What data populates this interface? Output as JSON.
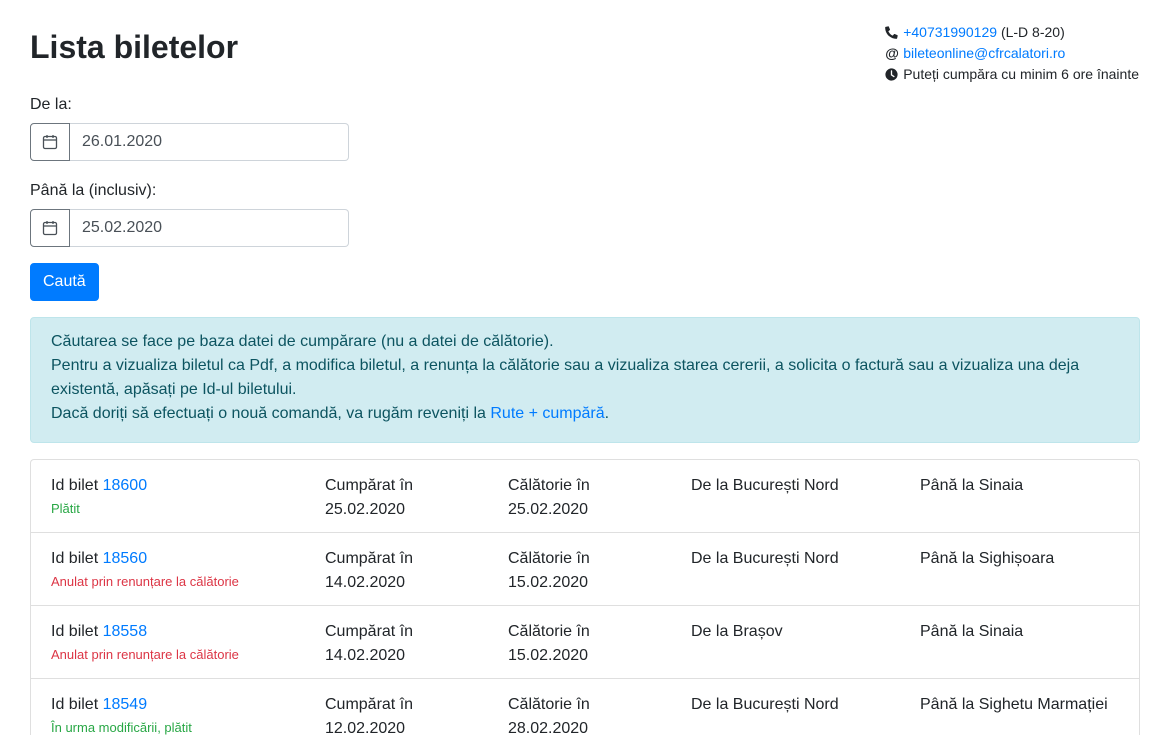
{
  "page": {
    "title": "Lista biletelor"
  },
  "contact": {
    "phone": "+40731990129",
    "phone_hours": "(L-D 8-20)",
    "email": "bileteonline@cfrcalatori.ro",
    "notice": "Puteți cumpăra cu minim 6 ore înainte",
    "icons": [
      "phone-icon",
      "at-icon",
      "clock-icon"
    ]
  },
  "filters": {
    "from_label": "De la:",
    "from_value": "26.01.2020",
    "to_label": "Până la (inclusiv):",
    "to_value": "25.02.2020",
    "search_label": "Caută"
  },
  "info": {
    "line1": "Căutarea se face pe baza datei de cumpărare (nu a datei de călătorie).",
    "line2": "Pentru a vizualiza biletul ca Pdf, a modifica biletul, a renunța la călătorie sau a vizualiza starea cererii, a solicita o factură sau a vizualiza una deja existentă, apăsați pe Id-ul biletului.",
    "line3_prefix": "Dacă doriți să efectuați o nouă comandă, va rugăm reveniți la ",
    "line3_link": "Rute + cumpără",
    "line3_suffix": "."
  },
  "tickets": [
    {
      "id_label": "Id bilet",
      "id": "18600",
      "status": "Plătit",
      "status_type": "ok",
      "bought_label": "Cumpărat în",
      "bought": "25.02.2020",
      "travel_label": "Călătorie în",
      "travel": "25.02.2020",
      "from": "De la București Nord",
      "to": "Până la Sinaia"
    },
    {
      "id_label": "Id bilet",
      "id": "18560",
      "status": "Anulat prin renunțare la călătorie",
      "status_type": "bad",
      "bought_label": "Cumpărat în",
      "bought": "14.02.2020",
      "travel_label": "Călătorie în",
      "travel": "15.02.2020",
      "from": "De la București Nord",
      "to": "Până la Sighișoara"
    },
    {
      "id_label": "Id bilet",
      "id": "18558",
      "status": "Anulat prin renunțare la călătorie",
      "status_type": "bad",
      "bought_label": "Cumpărat în",
      "bought": "14.02.2020",
      "travel_label": "Călătorie în",
      "travel": "15.02.2020",
      "from": "De la Brașov",
      "to": "Până la Sinaia"
    },
    {
      "id_label": "Id bilet",
      "id": "18549",
      "status": "În urma modificării, plătit",
      "status_type": "ok",
      "bought_label": "Cumpărat în",
      "bought": "12.02.2020",
      "travel_label": "Călătorie în",
      "travel": "28.02.2020",
      "from": "De la București Nord",
      "to": "Până la Sighetu Marmației"
    }
  ],
  "colors": {
    "primary": "#007bff",
    "info_bg": "#d1ecf1",
    "info_text": "#0c5460",
    "success": "#28a745",
    "danger": "#dc3545"
  }
}
